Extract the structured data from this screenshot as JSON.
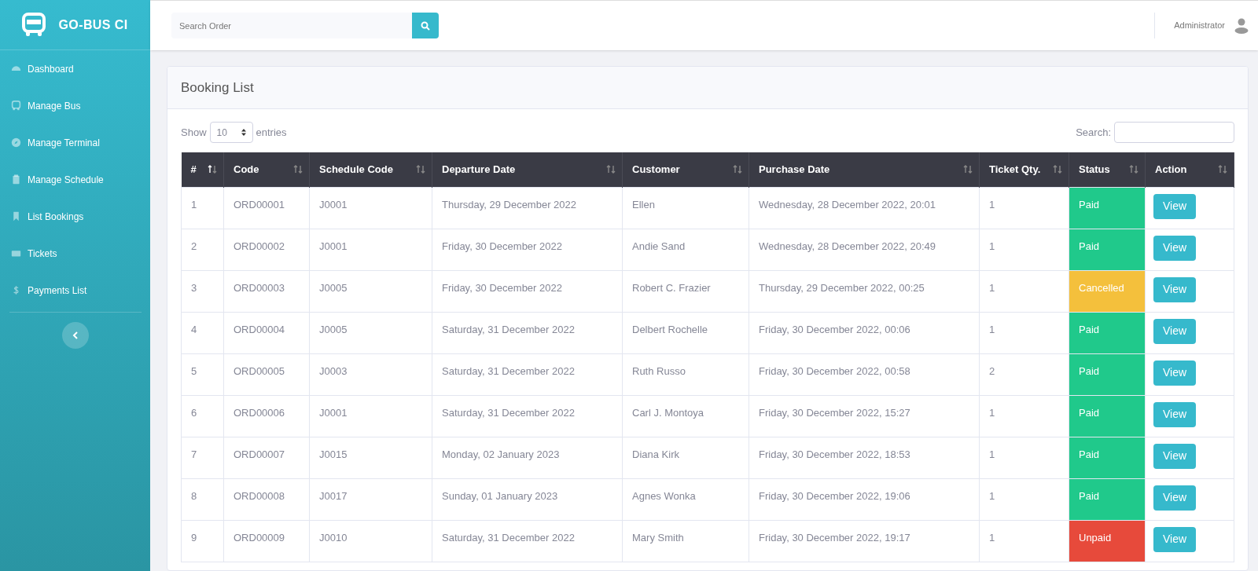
{
  "sidebar": {
    "brand": "GO-BUS CI",
    "items": [
      {
        "label": "Dashboard"
      },
      {
        "label": "Manage Bus"
      },
      {
        "label": "Manage Terminal"
      },
      {
        "label": "Manage Schedule"
      },
      {
        "label": "List Bookings"
      },
      {
        "label": "Tickets"
      },
      {
        "label": "Payments List"
      }
    ]
  },
  "header": {
    "search": {
      "placeholder": "Search Order"
    },
    "user": "Administrator"
  },
  "card": {
    "title": "Booking List",
    "show_label": "Show",
    "page_size": "10",
    "entries_label": "entries",
    "search_label": "Search:"
  },
  "table": {
    "columns": [
      {
        "label": "#",
        "sorted": true
      },
      {
        "label": "Code",
        "sorted": false
      },
      {
        "label": "Schedule Code",
        "sorted": false
      },
      {
        "label": "Departure Date",
        "sorted": false
      },
      {
        "label": "Customer",
        "sorted": false
      },
      {
        "label": "Purchase Date",
        "sorted": false
      },
      {
        "label": "Ticket Qty.",
        "sorted": false
      },
      {
        "label": "Status",
        "sorted": false
      },
      {
        "label": "Action",
        "sorted": false
      }
    ],
    "rows": [
      {
        "cells": [
          "1",
          "ORD00001",
          "J0001",
          "Thursday, 29 December 2022",
          "Ellen",
          "Wednesday, 28 December 2022, 20:01",
          "1"
        ],
        "status": {
          "label": "Paid",
          "color": "#20c98b"
        },
        "action": "View"
      },
      {
        "cells": [
          "2",
          "ORD00002",
          "J0001",
          "Friday, 30 December 2022",
          "Andie Sand",
          "Wednesday, 28 December 2022, 20:49",
          "1"
        ],
        "status": {
          "label": "Paid",
          "color": "#20c98b"
        },
        "action": "View"
      },
      {
        "cells": [
          "3",
          "ORD00003",
          "J0005",
          "Friday, 30 December 2022",
          "Robert C. Frazier",
          "Thursday, 29 December 2022, 00:25",
          "1"
        ],
        "status": {
          "label": "Cancelled",
          "color": "#f4c03c"
        },
        "action": "View"
      },
      {
        "cells": [
          "4",
          "ORD00004",
          "J0005",
          "Saturday, 31 December 2022",
          "Delbert Rochelle",
          "Friday, 30 December 2022, 00:06",
          "1"
        ],
        "status": {
          "label": "Paid",
          "color": "#20c98b"
        },
        "action": "View"
      },
      {
        "cells": [
          "5",
          "ORD00005",
          "J0003",
          "Saturday, 31 December 2022",
          "Ruth Russo",
          "Friday, 30 December 2022, 00:58",
          "2"
        ],
        "status": {
          "label": "Paid",
          "color": "#20c98b"
        },
        "action": "View"
      },
      {
        "cells": [
          "6",
          "ORD00006",
          "J0001",
          "Saturday, 31 December 2022",
          "Carl J. Montoya",
          "Friday, 30 December 2022, 15:27",
          "1"
        ],
        "status": {
          "label": "Paid",
          "color": "#20c98b"
        },
        "action": "View"
      },
      {
        "cells": [
          "7",
          "ORD00007",
          "J0015",
          "Monday, 02 January 2023",
          "Diana Kirk",
          "Friday, 30 December 2022, 18:53",
          "1"
        ],
        "status": {
          "label": "Paid",
          "color": "#20c98b"
        },
        "action": "View"
      },
      {
        "cells": [
          "8",
          "ORD00008",
          "J0017",
          "Sunday, 01 January 2023",
          "Agnes Wonka",
          "Friday, 30 December 2022, 19:06",
          "1"
        ],
        "status": {
          "label": "Paid",
          "color": "#20c98b"
        },
        "action": "View"
      },
      {
        "cells": [
          "9",
          "ORD00009",
          "J0010",
          "Saturday, 31 December 2022",
          "Mary Smith",
          "Friday, 30 December 2022, 19:17",
          "1"
        ],
        "status": {
          "label": "Unpaid",
          "color": "#e74a3b"
        },
        "action": "View"
      }
    ]
  }
}
